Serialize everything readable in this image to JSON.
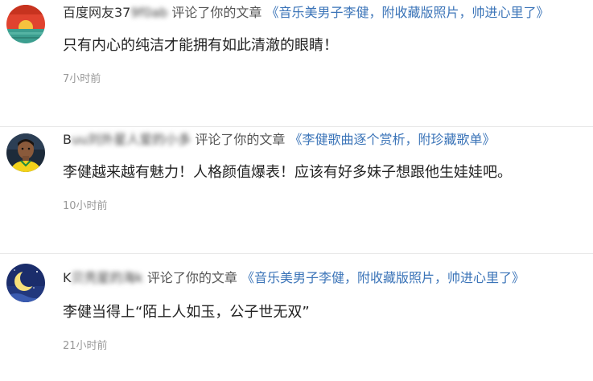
{
  "comments": [
    {
      "username_visible": "百度网友37",
      "username_blurred": "9f0ab",
      "verb": "评论了你的文章",
      "article": "《音乐美男子李健，附收藏版照片，帅进心里了》",
      "content": "只有内心的纯洁才能拥有如此清澈的眼睛！",
      "time": "7小时前"
    },
    {
      "username_visible": "B",
      "username_blurred": "uu刘外星人爱的小多",
      "verb": "评论了你的文章",
      "article": "《李健歌曲逐个赏析，附珍藏歌单》",
      "content": "李健越来越有魅力！人格颜值爆表！应该有好多妹子想跟他生娃娃吧。",
      "time": "10小时前"
    },
    {
      "username_visible": "K",
      "username_blurred": "贝壳星的海k",
      "verb": "评论了你的文章",
      "article": "《音乐美男子李健，附收藏版照片，帅进心里了》",
      "content": "李健当得上“陌上人如玉，公子世无双”",
      "time": "21小时前"
    }
  ]
}
